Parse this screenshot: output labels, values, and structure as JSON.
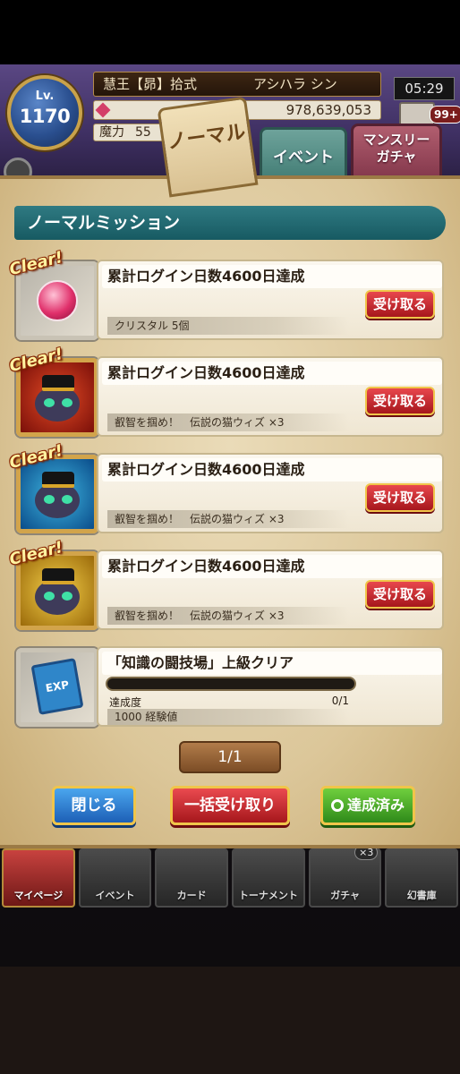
{
  "header": {
    "level_label": "Lv.",
    "level": "1170",
    "title": "慧王【昴】拾式",
    "player_name": "アシハラ シン",
    "crystals": "978,639,053",
    "mp_label": "魔力",
    "mp_value": "55",
    "time": "05:29",
    "mail_count": "99+"
  },
  "tabs": [
    {
      "label": "ノーマル",
      "active": true
    },
    {
      "label": "イベント",
      "active": false
    },
    {
      "label": "マンスリー\nガチャ",
      "active": false
    }
  ],
  "section_title": "ノーマルミッション",
  "clear_label": "Clear!",
  "missions": [
    {
      "title": "累計ログイン日数4600日達成",
      "reward": "クリスタル 5個",
      "cleared": true,
      "button": "受け取る",
      "icon": "crystal-gem-icon"
    },
    {
      "title": "累計ログイン日数4600日達成",
      "reward": "叡智を掴め！　伝説の猫ウィズ ×3",
      "cleared": true,
      "button": "受け取る",
      "icon": "wiz-cat-red-icon"
    },
    {
      "title": "累計ログイン日数4600日達成",
      "reward": "叡智を掴め！　伝説の猫ウィズ ×3",
      "cleared": true,
      "button": "受け取る",
      "icon": "wiz-cat-blue-icon"
    },
    {
      "title": "累計ログイン日数4600日達成",
      "reward": "叡智を掴め！　伝説の猫ウィズ ×3",
      "cleared": true,
      "button": "受け取る",
      "icon": "wiz-cat-gold-icon"
    },
    {
      "title": "「知識の闘技場」上級クリア",
      "reward": "1000 経験値",
      "cleared": false,
      "progress_label": "達成度",
      "progress_count": "0/1",
      "progress": 0,
      "icon": "exp-book-icon",
      "icon_text": "EXP"
    }
  ],
  "pager": "1/1",
  "buttons": {
    "close": "閉じる",
    "claim_all": "一括受け取り",
    "completed": "達成済み"
  },
  "nav": [
    {
      "label": "マイページ",
      "active": true
    },
    {
      "label": "イベント",
      "active": false
    },
    {
      "label": "カード",
      "active": false
    },
    {
      "label": "トーナメント",
      "active": false
    },
    {
      "label": "ガチャ",
      "active": false,
      "badge": "×3"
    },
    {
      "label": "幻書庫",
      "active": false
    }
  ],
  "colors": {
    "accent_teal": "#175a62",
    "claim_red": "#a6171c",
    "close_blue": "#1d5fb6",
    "done_green": "#2f8a1a",
    "parchment": "#eadbb8"
  }
}
